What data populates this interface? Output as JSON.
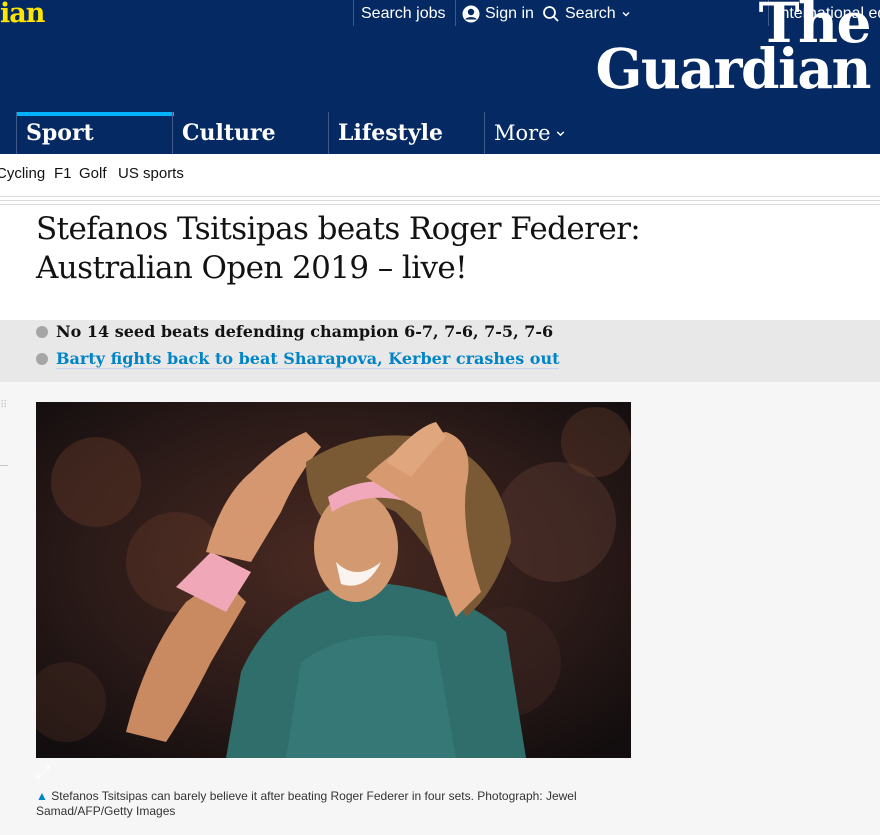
{
  "header": {
    "brand_fragment": "ian",
    "search_jobs": "Search jobs",
    "sign_in": "Sign in",
    "search": "Search",
    "edition": "International ed",
    "masthead_line1": "The",
    "masthead_line2": "Guardian"
  },
  "nav": {
    "pillars": [
      "Sport",
      "Culture",
      "Lifestyle"
    ],
    "more": "More",
    "active": "Sport",
    "active_color": "#00b2ff"
  },
  "subnav": {
    "links": [
      "Cycling",
      "F1",
      "Golf",
      "US sports"
    ]
  },
  "article": {
    "headline_line1": "Stefanos Tsitsipas beats Roger Federer:",
    "headline_line2": "Australian Open 2019 – live!",
    "standfirst": [
      "No 14 seed beats defending champion 6-7, 7-6, 7-5, 7-6",
      "Barty fights back to beat Sharapova, Kerber crashes out"
    ],
    "caption": "Stefanos Tsitsipas can barely believe it after beating Roger Federer in four sets. Photograph: Jewel Samad/AFP/Getty Images"
  },
  "colors": {
    "header_bg": "#052962",
    "brand_yellow": "#ffe500",
    "link_blue": "#0084c6"
  },
  "icons": [
    "person-icon",
    "search-icon",
    "chevron-down-icon",
    "expand-icon",
    "caption-triangle-icon"
  ]
}
